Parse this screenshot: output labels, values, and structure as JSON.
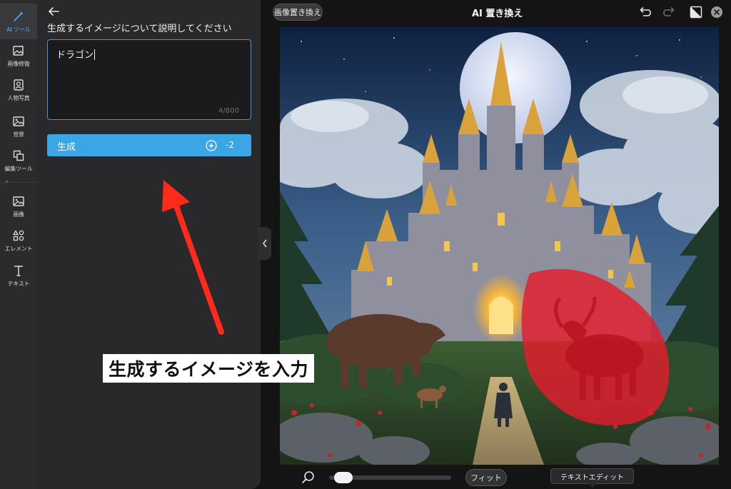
{
  "rail": {
    "items": [
      {
        "id": "ai-tools",
        "label": "AI ツール",
        "icon": "magic-wand-icon",
        "active": true
      },
      {
        "id": "image-repair",
        "label": "画像修復",
        "icon": "image-sparkle-icon"
      },
      {
        "id": "portrait",
        "label": "人物写真",
        "icon": "portrait-icon"
      },
      {
        "id": "background",
        "label": "背景",
        "icon": "background-image-icon"
      },
      {
        "id": "edit-tools",
        "label": "編集ツール",
        "icon": "layers-icon"
      },
      {
        "id": "image",
        "label": "画像",
        "icon": "image-icon"
      },
      {
        "id": "elements",
        "label": "エレメント",
        "icon": "shapes-icon"
      },
      {
        "id": "text",
        "label": "テキスト",
        "icon": "text-icon"
      }
    ],
    "plus": "+"
  },
  "panel": {
    "title": "生成するイメージについて説明してください",
    "prompt_value": "ドラゴン",
    "char_count": "4/800",
    "generate_label": "生成",
    "credit_cost": "-2"
  },
  "topbar": {
    "replace_label": "画像置き換え",
    "title": "AI 置き換え"
  },
  "bottombar": {
    "fit_label": "フィット",
    "text_edit_label": "テキストエディット",
    "zoom_level": 0.05
  },
  "annotation": {
    "text": "生成するイメージを入力"
  },
  "colors": {
    "accent": "#3aa6e4",
    "focus_border": "#2f9de0",
    "annotation_arrow": "#ff2a1a",
    "mask_red": "#e31c2c"
  }
}
